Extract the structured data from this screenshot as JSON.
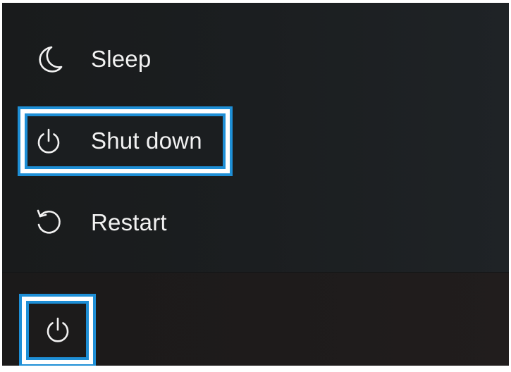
{
  "power_menu": {
    "items": [
      {
        "label": "Sleep",
        "icon": "moon-icon"
      },
      {
        "label": "Shut down",
        "icon": "power-icon"
      },
      {
        "label": "Restart",
        "icon": "restart-icon"
      }
    ]
  },
  "start_bar": {
    "power_button_icon": "power-icon"
  },
  "colors": {
    "highlight": "#1e8fd6",
    "menu_background": "#1b1e20",
    "text": "#f2f2f2"
  }
}
